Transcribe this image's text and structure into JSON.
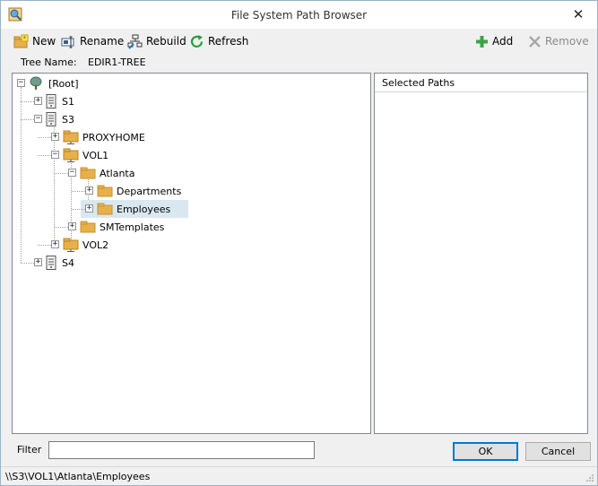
{
  "window": {
    "title": "File System Path Browser",
    "close_glyph": "✕"
  },
  "toolbar": {
    "new_label": "New",
    "rename_label": "Rename",
    "rebuild_label": "Rebuild",
    "refresh_label": "Refresh",
    "add_label": "Add",
    "remove_label": "Remove"
  },
  "tree_name": {
    "label": "Tree Name:",
    "value": "EDIR1-TREE"
  },
  "tree": {
    "nodes": [
      {
        "label": "[Root]",
        "icon": "tree-root-icon",
        "expander": "−"
      },
      {
        "label": "S1",
        "icon": "server-icon",
        "expander": "+"
      },
      {
        "label": "S3",
        "icon": "server-icon",
        "expander": "−"
      },
      {
        "label": "PROXYHOME",
        "icon": "volume-icon",
        "expander": "+"
      },
      {
        "label": "VOL1",
        "icon": "volume-icon",
        "expander": "−"
      },
      {
        "label": "Atlanta",
        "icon": "folder-icon",
        "expander": "−"
      },
      {
        "label": "Departments",
        "icon": "folder-icon",
        "expander": "+"
      },
      {
        "label": "Employees",
        "icon": "folder-icon",
        "expander": "+",
        "selected": true
      },
      {
        "label": "SMTemplates",
        "icon": "folder-icon",
        "expander": "+"
      },
      {
        "label": "VOL2",
        "icon": "volume-icon",
        "expander": "+"
      },
      {
        "label": "S4",
        "icon": "server-icon",
        "expander": "+"
      }
    ]
  },
  "selected_paths": {
    "header": "Selected Paths"
  },
  "filter": {
    "label": "Filter",
    "value": ""
  },
  "buttons": {
    "ok_label": "OK",
    "cancel_label": "Cancel"
  },
  "status": {
    "path": "\\\\S3\\VOL1\\Atlanta\\Employees"
  },
  "colors": {
    "folder": "#e8b04b",
    "add_green": "#3aa34a",
    "refresh_green": "#2e9a3c",
    "selection": "#d9e8f0"
  }
}
